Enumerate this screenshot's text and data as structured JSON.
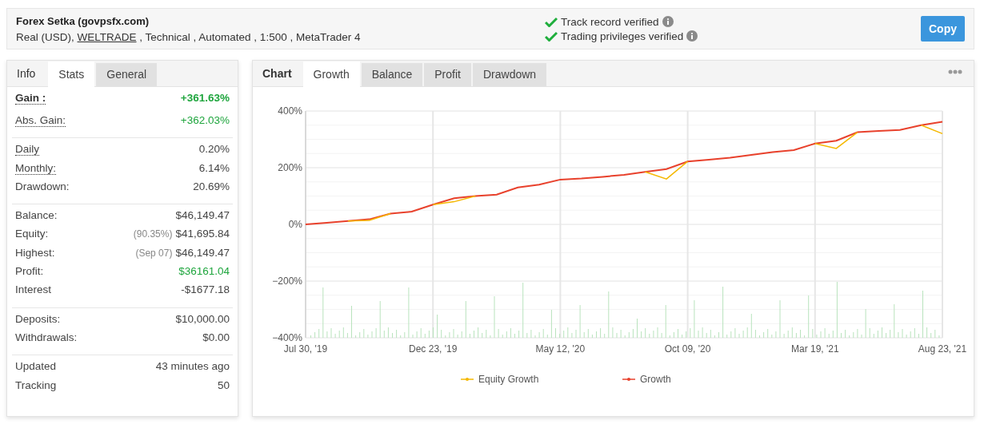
{
  "header": {
    "title": "Forex Setka (govpsfx.com)",
    "details_before": "Real (USD), ",
    "broker_link": "WELTRADE",
    "details_after": " , Technical , Automated , 1:500 , MetaTrader 4",
    "verifications": [
      {
        "label": "Track record verified",
        "verified": true
      },
      {
        "label": "Trading privileges verified",
        "verified": true
      }
    ],
    "copy_button": "Copy"
  },
  "stats_panel": {
    "heading": "Info",
    "tabs": [
      {
        "label": "Stats",
        "selected": true
      },
      {
        "label": "General",
        "selected": false
      }
    ],
    "groups": [
      [
        {
          "label": "Gain :",
          "value": "+361.63%",
          "headline": true,
          "dotted": true,
          "positive": true
        },
        {
          "label": "Abs. Gain:",
          "value": "+362.03%",
          "headline": false,
          "dotted": true,
          "positive": true
        }
      ],
      [
        {
          "label": "Daily",
          "value": "0.20%",
          "headline": false,
          "dotted": true,
          "positive": false
        },
        {
          "label": "Monthly:",
          "value": "6.14%",
          "headline": false,
          "dotted": true,
          "positive": false
        },
        {
          "label": "Drawdown:",
          "value": "20.69%",
          "headline": false,
          "dotted": false,
          "positive": false
        }
      ],
      [
        {
          "label": "Balance:",
          "value": "$46,149.47",
          "headline": false,
          "dotted": false,
          "positive": false
        },
        {
          "label": "Equity:",
          "note": "(90.35%)",
          "value": "$41,695.84",
          "headline": false,
          "dotted": false,
          "positive": false
        },
        {
          "label": "Highest:",
          "note": "(Sep 07)",
          "value": "$46,149.47",
          "headline": false,
          "dotted": false,
          "positive": false
        },
        {
          "label": "Profit:",
          "value": "$36161.04",
          "headline": false,
          "dotted": false,
          "positive": true
        },
        {
          "label": "Interest",
          "value": "-$1677.18",
          "headline": false,
          "dotted": false,
          "positive": false
        }
      ],
      [
        {
          "label": "Deposits:",
          "value": "$10,000.00",
          "headline": false,
          "dotted": false,
          "positive": false
        },
        {
          "label": "Withdrawals:",
          "value": "$0.00",
          "headline": false,
          "dotted": false,
          "positive": false
        }
      ],
      [
        {
          "label": "Updated",
          "value": "43 minutes ago",
          "headline": false,
          "dotted": false,
          "positive": false
        },
        {
          "label": "Tracking",
          "value": "50",
          "headline": false,
          "dotted": false,
          "positive": false
        }
      ]
    ]
  },
  "chart_panel": {
    "heading": "Chart",
    "tabs": [
      {
        "label": "Growth",
        "selected": true
      },
      {
        "label": "Balance",
        "selected": false
      },
      {
        "label": "Profit",
        "selected": false
      },
      {
        "label": "Drawdown",
        "selected": false
      }
    ],
    "chart_data": {
      "type": "line",
      "categories": [
        "Jul 30, '19",
        null,
        null,
        null,
        null,
        null,
        "Dec 23, '19",
        null,
        null,
        null,
        null,
        null,
        "May 12, '20",
        null,
        null,
        null,
        null,
        null,
        "Oct 09, '20",
        null,
        null,
        null,
        null,
        null,
        "Mar 19, '21",
        null,
        null,
        null,
        null,
        null,
        "Aug 23, '21"
      ],
      "series": [
        {
          "name": "Equity Growth",
          "color": "#f5b800",
          "values": [
            null,
            null,
            12,
            14,
            38,
            null,
            70,
            80,
            100,
            null,
            null,
            null,
            null,
            null,
            null,
            null,
            185,
            160,
            222,
            null,
            null,
            null,
            null,
            null,
            285,
            268,
            325,
            null,
            null,
            350,
            320
          ]
        },
        {
          "name": "Growth",
          "color": "#e8412c",
          "values": [
            0,
            6,
            12,
            18,
            38,
            45,
            70,
            92,
            100,
            105,
            130,
            140,
            158,
            162,
            168,
            175,
            185,
            195,
            222,
            228,
            235,
            245,
            255,
            262,
            285,
            295,
            325,
            330,
            333,
            350,
            362
          ]
        }
      ],
      "ylim": [
        -400,
        400
      ],
      "grid": true,
      "legend": true,
      "yticks": [
        {
          "value": 400,
          "label": "400%"
        },
        {
          "value": 200,
          "label": "200%"
        },
        {
          "value": 0,
          "label": "0%"
        },
        {
          "value": -200,
          "label": "−200%"
        },
        {
          "value": -400,
          "label": "−400%"
        }
      ]
    }
  }
}
